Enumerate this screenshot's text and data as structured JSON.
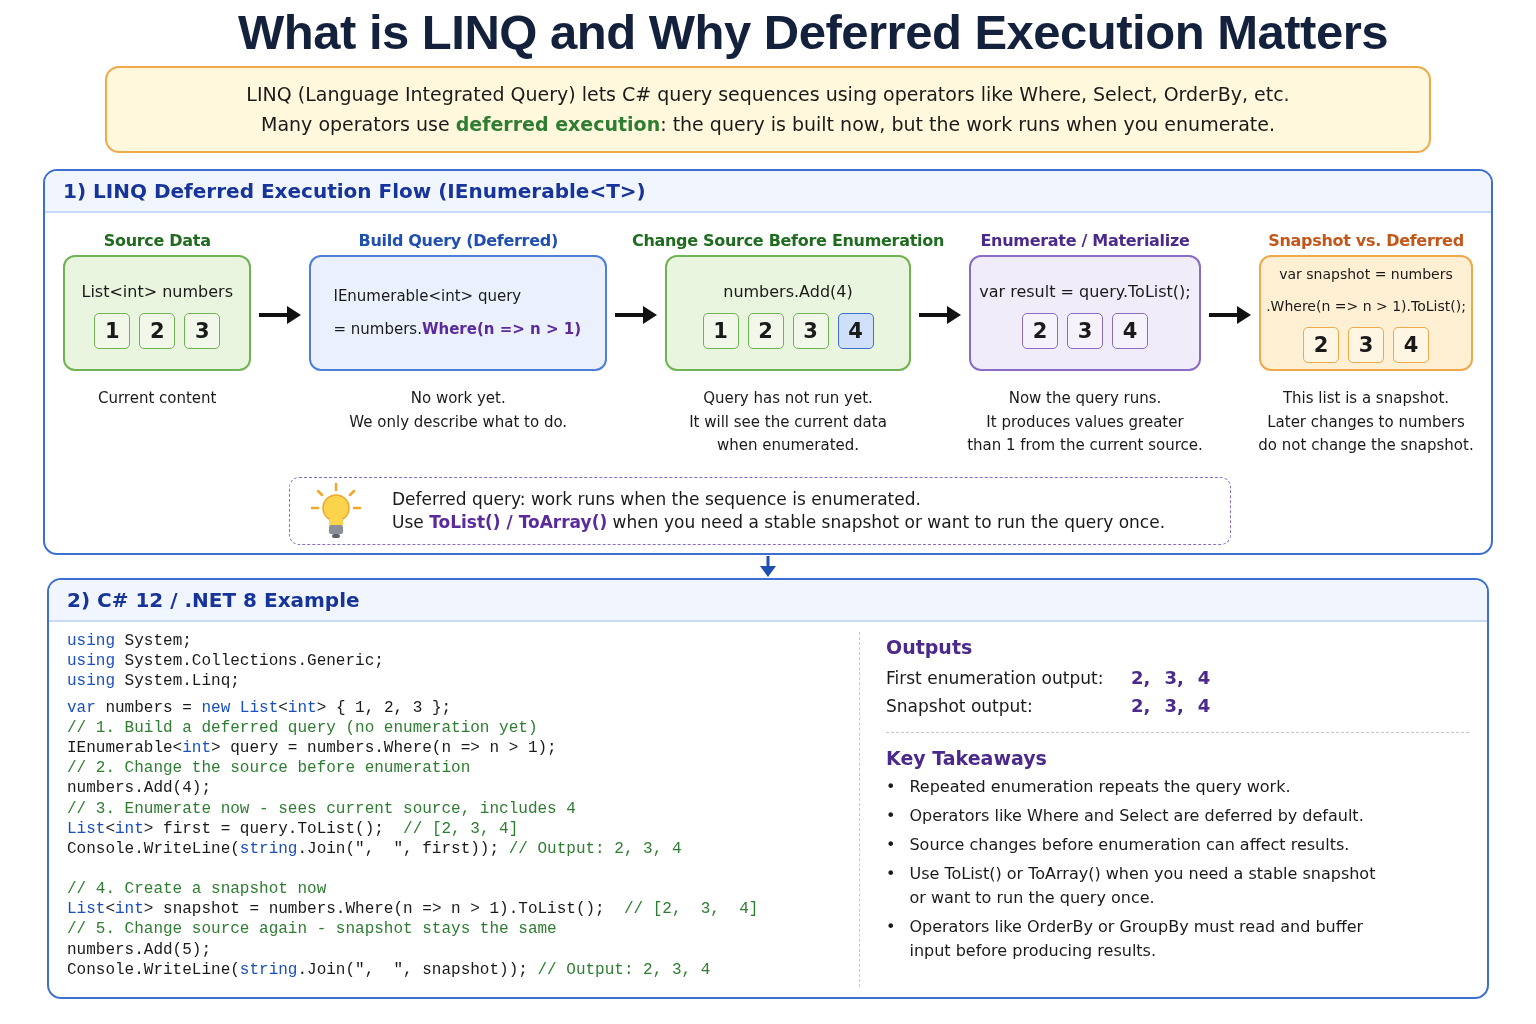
{
  "title": "What is LINQ and Why Deferred Execution Matters",
  "intro": [
    [
      {
        "kind": "plain",
        "text": "LINQ (Language Integrated Query) lets C# query sequences using operators like Where, Select, OrderBy, etc."
      }
    ],
    [
      {
        "kind": "plain",
        "text": "Many operators use "
      },
      {
        "kind": "accent",
        "text": "deferred execution"
      },
      {
        "kind": "plain",
        "text": ": the query is built now, but the work runs when you enumerate."
      }
    ]
  ],
  "flow": {
    "heading": "1)  LINQ Deferred Execution Flow (IEnumerable<T>)",
    "stages": [
      {
        "heading": "Source Data",
        "color": "#1f6b1f",
        "kind": "green",
        "code": [
          [
            {
              "kind": "plain",
              "text": "List<int>  numbers"
            }
          ]
        ],
        "chips": [
          {
            "value": "1",
            "highlighted": false
          },
          {
            "value": "2",
            "highlighted": false
          },
          {
            "value": "3",
            "highlighted": false
          }
        ],
        "caption": [
          "Current content"
        ]
      },
      {
        "heading": "Build Query (Deferred)",
        "color": "#1f4fb0",
        "kind": "blue",
        "code": [
          [
            {
              "kind": "plain",
              "text": "IEnumerable<int>  query"
            }
          ],
          [
            {
              "kind": "plain",
              "text": "= numbers."
            },
            {
              "kind": "accent",
              "text": "Where(n  =>  n > 1)"
            }
          ]
        ],
        "caption": [
          "No work yet.",
          "We only describe what to do."
        ]
      },
      {
        "heading": "Change Source Before Enumeration",
        "color": "#1f6b1f",
        "kind": "green",
        "code": [
          [
            {
              "kind": "plain",
              "text": "numbers.Add(4)"
            }
          ]
        ],
        "chips": [
          {
            "value": "1",
            "highlighted": false
          },
          {
            "value": "2",
            "highlighted": false
          },
          {
            "value": "3",
            "highlighted": false
          },
          {
            "value": "4",
            "highlighted": true
          }
        ],
        "caption": [
          "Query has not run yet.",
          "It will see the current data",
          "when enumerated."
        ]
      },
      {
        "heading": "Enumerate / Materialize",
        "color": "#4b2a8c",
        "kind": "purple",
        "code": [
          [
            {
              "kind": "plain",
              "text": "var result = query.ToList();"
            }
          ]
        ],
        "chips": [
          {
            "value": "2",
            "highlighted": false
          },
          {
            "value": "3",
            "highlighted": false
          },
          {
            "value": "4",
            "highlighted": false
          }
        ],
        "caption": [
          "Now the query runs.",
          "It produces values greater",
          "than 1 from the current source."
        ]
      },
      {
        "heading": "Snapshot vs. Deferred",
        "color": "#c4561a",
        "kind": "orange",
        "code": [
          [
            {
              "kind": "plain",
              "text": "var snapshot = numbers"
            }
          ],
          [
            {
              "kind": "plain",
              "text": ".Where(n => n > 1).ToList();"
            }
          ]
        ],
        "chips": [
          {
            "value": "2",
            "highlighted": false
          },
          {
            "value": "3",
            "highlighted": false
          },
          {
            "value": "4",
            "highlighted": false
          }
        ],
        "caption": [
          "This list is a snapshot.",
          "Later changes to numbers",
          "do not change the snapshot."
        ]
      }
    ],
    "note": [
      [
        {
          "kind": "plain",
          "text": "Deferred query: work runs when the sequence is enumerated."
        }
      ],
      [
        {
          "kind": "plain",
          "text": "Use "
        },
        {
          "kind": "accent",
          "text": "ToList() / ToArray()"
        },
        {
          "kind": "plain",
          "text": " when you need a stable snapshot or want to run the query once."
        }
      ]
    ]
  },
  "example": {
    "heading": "2)  C# 12 / .NET 8 Example",
    "code_blocks": [
      [
        [
          {
            "kind": "kw",
            "text": "using"
          },
          {
            "kind": "plain",
            "text": " System;"
          }
        ],
        [
          {
            "kind": "kw",
            "text": "using"
          },
          {
            "kind": "plain",
            "text": " System.Collections.Generic;"
          }
        ],
        [
          {
            "kind": "kw",
            "text": "using"
          },
          {
            "kind": "plain",
            "text": " System.Linq;"
          }
        ]
      ],
      [
        [
          {
            "kind": "kw",
            "text": "var"
          },
          {
            "kind": "plain",
            "text": " numbers = "
          },
          {
            "kind": "kw",
            "text": "new List"
          },
          {
            "kind": "plain",
            "text": "<"
          },
          {
            "kind": "kw",
            "text": "int"
          },
          {
            "kind": "plain",
            "text": "> { 1, 2, 3 };"
          }
        ],
        [
          {
            "kind": "comment",
            "text": "// 1. Build a deferred query (no enumeration yet)"
          }
        ],
        [
          {
            "kind": "plain",
            "text": "IEnumerable<"
          },
          {
            "kind": "kw",
            "text": "int"
          },
          {
            "kind": "plain",
            "text": "> query = numbers.Where(n => n > 1);"
          }
        ],
        [
          {
            "kind": "comment",
            "text": "// 2. Change the source before enumeration"
          }
        ],
        [
          {
            "kind": "plain",
            "text": "numbers.Add(4);"
          }
        ],
        [
          {
            "kind": "comment",
            "text": "// 3. Enumerate now - sees current source, includes 4"
          }
        ],
        [
          {
            "kind": "kw",
            "text": "List"
          },
          {
            "kind": "plain",
            "text": "<"
          },
          {
            "kind": "kw",
            "text": "int"
          },
          {
            "kind": "plain",
            "text": "> first = query.ToList();  "
          },
          {
            "kind": "comment",
            "text": "// [2, 3, 4]"
          }
        ],
        [
          {
            "kind": "plain",
            "text": "Console.WriteLine("
          },
          {
            "kind": "kw",
            "text": "string"
          },
          {
            "kind": "plain",
            "text": ".Join(\",  \", first)); "
          },
          {
            "kind": "comment",
            "text": "// Output: 2, 3, 4"
          }
        ]
      ],
      [
        [
          {
            "kind": "comment",
            "text": "// 4. Create a snapshot now"
          }
        ],
        [
          {
            "kind": "kw",
            "text": "List"
          },
          {
            "kind": "plain",
            "text": "<"
          },
          {
            "kind": "kw",
            "text": "int"
          },
          {
            "kind": "plain",
            "text": "> snapshot = numbers.Where(n => n > 1).ToList();  "
          },
          {
            "kind": "comment",
            "text": "// [2,  3,  4]"
          }
        ],
        [
          {
            "kind": "comment",
            "text": "// 5. Change source again - snapshot stays the same"
          }
        ],
        [
          {
            "kind": "plain",
            "text": "numbers.Add(5);"
          }
        ],
        [
          {
            "kind": "plain",
            "text": "Console.WriteLine("
          },
          {
            "kind": "kw",
            "text": "string"
          },
          {
            "kind": "plain",
            "text": ".Join(\",  \", snapshot)); "
          },
          {
            "kind": "comment",
            "text": "// Output: 2, 3, 4"
          }
        ]
      ]
    ],
    "outputs": {
      "heading": "Outputs",
      "rows": [
        {
          "label": "First enumeration output:",
          "values": [
            "2,",
            "3,",
            "4"
          ]
        },
        {
          "label": "Snapshot output:",
          "values": [
            "2,",
            "3,",
            "4"
          ]
        }
      ]
    },
    "takeaways": {
      "heading": "Key Takeaways",
      "items": [
        {
          "marker": "•",
          "text": "Repeated enumeration repeats the query work."
        },
        {
          "marker": "•",
          "text": "Operators like Where and Select are deferred by default."
        },
        {
          "marker": "•",
          "text": "Source changes before enumeration can affect results."
        },
        {
          "marker": "•",
          "text": "Use ToList() or ToArray() when you need a stable snapshot or want to run the query once."
        },
        {
          "marker": "•",
          "text": "Operators like OrderBy or GroupBy must read and buffer input before producing results."
        }
      ]
    }
  }
}
